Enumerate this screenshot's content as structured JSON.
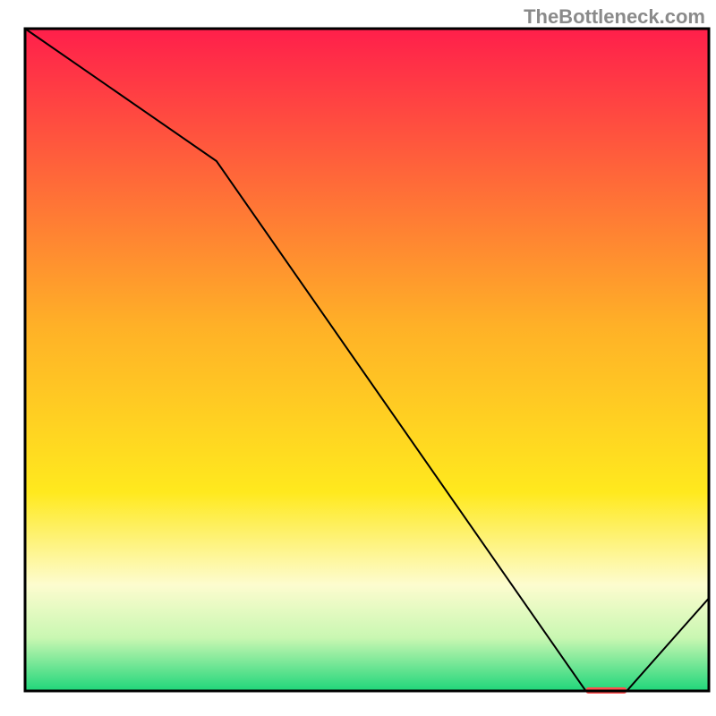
{
  "attribution": "TheBottleneck.com",
  "chart_data": {
    "type": "line",
    "title": "",
    "xlabel": "",
    "ylabel": "",
    "xlim": [
      0,
      100
    ],
    "ylim": [
      0,
      100
    ],
    "x": [
      0,
      28,
      82,
      88,
      100
    ],
    "values": [
      100,
      80,
      0,
      0,
      14
    ],
    "marker_segment": {
      "x_start": 82,
      "x_end": 88,
      "y": 0
    },
    "background_gradient": {
      "stops": [
        {
          "offset": 0.0,
          "color": "#ff1f4b"
        },
        {
          "offset": 0.45,
          "color": "#ffb127"
        },
        {
          "offset": 0.7,
          "color": "#ffe91e"
        },
        {
          "offset": 0.84,
          "color": "#fdfccf"
        },
        {
          "offset": 0.92,
          "color": "#c9f7b2"
        },
        {
          "offset": 1.0,
          "color": "#1fd67a"
        }
      ]
    },
    "frame_color": "#000000",
    "line_color": "#000000",
    "marker_color": "#ff4d4d"
  }
}
